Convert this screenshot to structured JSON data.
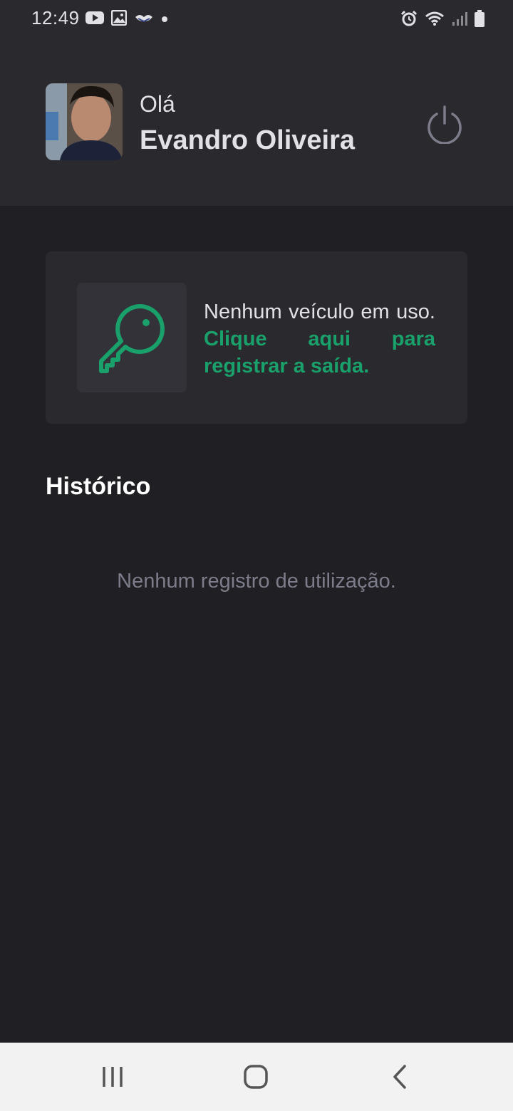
{
  "status_bar": {
    "time": "12:49",
    "left_icons": [
      "youtube-icon",
      "gallery-icon",
      "handshake-icon",
      "dot-icon"
    ],
    "right_icons": [
      "alarm-icon",
      "wifi-icon",
      "signal-icon",
      "battery-icon"
    ]
  },
  "header": {
    "greeting": "Olá",
    "user_name": "Evandro Oliveira",
    "logout_icon": "power-icon"
  },
  "vehicle_card": {
    "icon": "key-icon",
    "text": "Nenhum veículo em uso.",
    "link_text": "Clique aqui para registrar a saída.",
    "accent_color": "#1aa06a"
  },
  "history": {
    "title": "Histórico",
    "empty_message": "Nenhum registro de utilização."
  },
  "nav_bar": {
    "buttons": [
      "recent-apps-icon",
      "home-icon",
      "back-icon"
    ]
  },
  "colors": {
    "background": "#202024",
    "surface": "#29292e",
    "accent": "#1aa06a"
  }
}
